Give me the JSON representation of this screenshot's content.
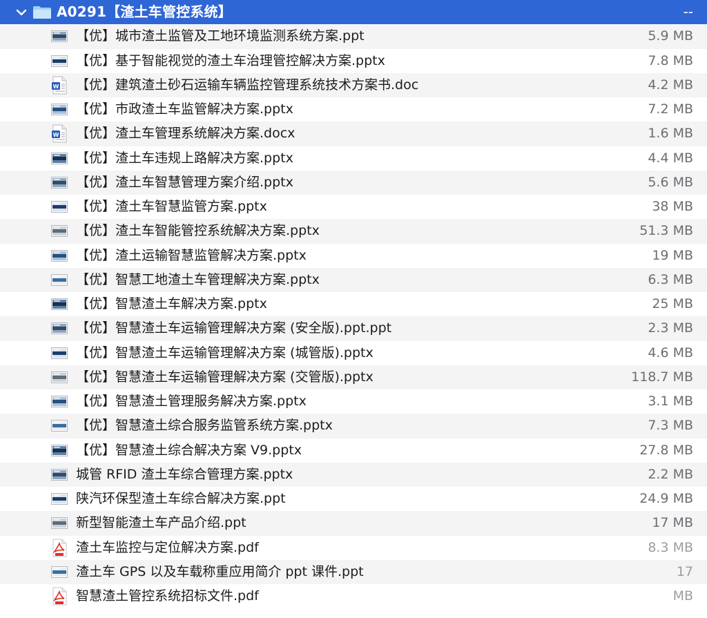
{
  "folder": {
    "name": "A0291【渣土车管控系统】",
    "size": "--",
    "bg_color": "#2f66d6"
  },
  "files": [
    {
      "name": "【优】城市渣土监管及工地环境监测系统方案.ppt",
      "size": "5.9 MB",
      "icon": "slide-thumbnail-icon"
    },
    {
      "name": "【优】基于智能视觉的渣土车治理管控解决方案.pptx",
      "size": "7.8 MB",
      "icon": "slide-thumbnail-icon"
    },
    {
      "name": "【优】建筑渣土砂石运输车辆监控管理系统技术方案书.doc",
      "size": "4.2 MB",
      "icon": "word-doc-icon"
    },
    {
      "name": "【优】市政渣土车监管解决方案.pptx",
      "size": "7.2 MB",
      "icon": "slide-thumbnail-icon"
    },
    {
      "name": "【优】渣土车管理系统解决方案.docx",
      "size": "1.6 MB",
      "icon": "word-doc-icon"
    },
    {
      "name": "【优】渣土车违规上路解决方案.pptx",
      "size": "4.4 MB",
      "icon": "slide-thumbnail-icon"
    },
    {
      "name": "【优】渣土车智慧管理方案介绍.pptx",
      "size": "5.6 MB",
      "icon": "slide-thumbnail-icon"
    },
    {
      "name": "【优】渣土车智慧监管方案.pptx",
      "size": "38 MB",
      "icon": "slide-thumbnail-icon"
    },
    {
      "name": "【优】渣土车智能管控系统解决方案.pptx",
      "size": "51.3 MB",
      "icon": "slide-thumbnail-icon"
    },
    {
      "name": "【优】渣土运输智慧监管解决方案.pptx",
      "size": "19 MB",
      "icon": "slide-thumbnail-icon"
    },
    {
      "name": "【优】智慧工地渣土车管理解决方案.pptx",
      "size": "6.3 MB",
      "icon": "slide-thumbnail-icon"
    },
    {
      "name": "【优】智慧渣土车解决方案.pptx",
      "size": "25 MB",
      "icon": "slide-thumbnail-icon"
    },
    {
      "name": "【优】智慧渣土车运输管理解决方案 (安全版).ppt.ppt",
      "size": "2.3 MB",
      "icon": "slide-thumbnail-icon"
    },
    {
      "name": "【优】智慧渣土车运输管理解决方案 (城管版).pptx",
      "size": "4.6 MB",
      "icon": "slide-thumbnail-icon"
    },
    {
      "name": "【优】智慧渣土车运输管理解决方案 (交管版).pptx",
      "size": "118.7 MB",
      "icon": "slide-thumbnail-icon"
    },
    {
      "name": "【优】智慧渣土管理服务解决方案.pptx",
      "size": "3.1 MB",
      "icon": "slide-thumbnail-icon"
    },
    {
      "name": "【优】智慧渣土综合服务监管系统方案.pptx",
      "size": "7.3 MB",
      "icon": "slide-thumbnail-icon"
    },
    {
      "name": "【优】智慧渣土综合解决方案 V9.pptx",
      "size": "27.8 MB",
      "icon": "slide-thumbnail-icon"
    },
    {
      "name": "城管 RFID 渣土车综合管理方案.pptx",
      "size": "2.2 MB",
      "icon": "slide-thumbnail-icon"
    },
    {
      "name": "陕汽环保型渣土车综合解决方案.ppt",
      "size": "24.9 MB",
      "icon": "slide-thumbnail-icon"
    },
    {
      "name": "新型智能渣土车产品介绍.ppt",
      "size": "17 MB",
      "icon": "slide-thumbnail-icon"
    },
    {
      "name": "渣土车监控与定位解决方案.pdf",
      "size": "8.3 MB",
      "icon": "pdf-icon"
    },
    {
      "name": "渣土车 GPS 以及车载称重应用简介 ppt 课件.ppt",
      "size": "17",
      "icon": "slide-thumbnail-icon"
    },
    {
      "name": "智慧渣土管控系统招标文件.pdf",
      "size": "MB",
      "icon": "pdf-icon"
    }
  ]
}
